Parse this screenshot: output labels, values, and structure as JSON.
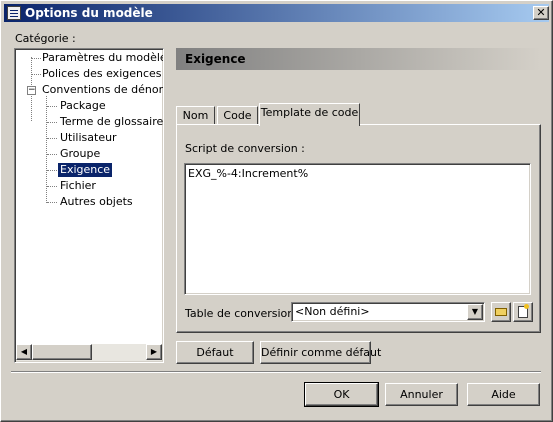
{
  "window": {
    "title": "Options du modèle",
    "close_glyph": "✕"
  },
  "categories": {
    "label": "Catégorie :",
    "items": [
      {
        "label": "Paramètres du modèle"
      },
      {
        "label": "Polices des exigences"
      },
      {
        "label": "Conventions de dénomina",
        "expanded": true,
        "expander_glyph": "−"
      },
      {
        "label": "Package"
      },
      {
        "label": "Terme de glossaire"
      },
      {
        "label": "Utilisateur"
      },
      {
        "label": "Groupe"
      },
      {
        "label": "Exigence",
        "selected": true
      },
      {
        "label": "Fichier"
      },
      {
        "label": "Autres objets"
      }
    ],
    "scroll_left_glyph": "◀",
    "scroll_right_glyph": "▶"
  },
  "section": {
    "header": "Exigence"
  },
  "tabs": [
    {
      "label": "Nom"
    },
    {
      "label": "Code"
    },
    {
      "label": "Template de code",
      "active": true
    }
  ],
  "script": {
    "label": "Script de conversion :",
    "value": "EXG_%-4:Increment%"
  },
  "conversion_table": {
    "label": "Table de conversion :",
    "selected": "<Non défini>",
    "dropdown_glyph": "▼"
  },
  "buttons": {
    "default": "Défaut",
    "set_default": "Définir comme défaut",
    "ok": "OK",
    "cancel": "Annuler",
    "help": "Aide"
  },
  "icons": {
    "browse": "folder-icon",
    "properties": "properties-icon"
  }
}
